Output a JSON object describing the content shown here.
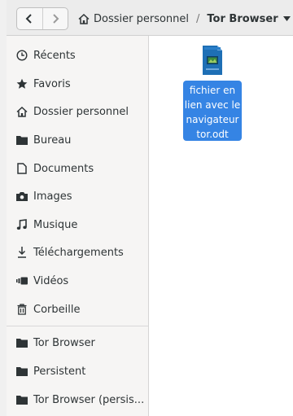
{
  "header": {
    "back_icon": "chevron-left-icon",
    "forward_icon": "chevron-right-icon",
    "breadcrumbs": [
      {
        "label": "Dossier personnel",
        "icon": "home-icon"
      },
      {
        "label": "Tor Browser",
        "current": true
      }
    ],
    "separator": "/",
    "dropdown_icon": "triangle-down-icon"
  },
  "sidebar": {
    "items": [
      {
        "label": "Récents",
        "icon": "clock-icon"
      },
      {
        "label": "Favoris",
        "icon": "star-icon"
      },
      {
        "label": "Dossier personnel",
        "icon": "home-icon"
      },
      {
        "label": "Bureau",
        "icon": "folder-icon"
      },
      {
        "label": "Documents",
        "icon": "document-icon"
      },
      {
        "label": "Images",
        "icon": "camera-icon"
      },
      {
        "label": "Musique",
        "icon": "music-icon"
      },
      {
        "label": "Téléchargements",
        "icon": "download-icon"
      },
      {
        "label": "Vidéos",
        "icon": "video-icon"
      },
      {
        "label": "Corbeille",
        "icon": "trash-icon"
      },
      {
        "label": "Tor Browser",
        "icon": "folder-icon"
      },
      {
        "label": "Persistent",
        "icon": "folder-icon"
      },
      {
        "label": "Tor Browser (persis...",
        "icon": "folder-icon"
      }
    ]
  },
  "content": {
    "files": [
      {
        "name_lines": [
          "fichier en",
          "lien avec le",
          "navigateur",
          "tor.odt"
        ],
        "icon": "odt-document-icon",
        "selected": true
      }
    ]
  },
  "colors": {
    "selection": "#3584e4",
    "sidebar_bg": "#f6f5f4",
    "header_bg": "#ececec"
  }
}
